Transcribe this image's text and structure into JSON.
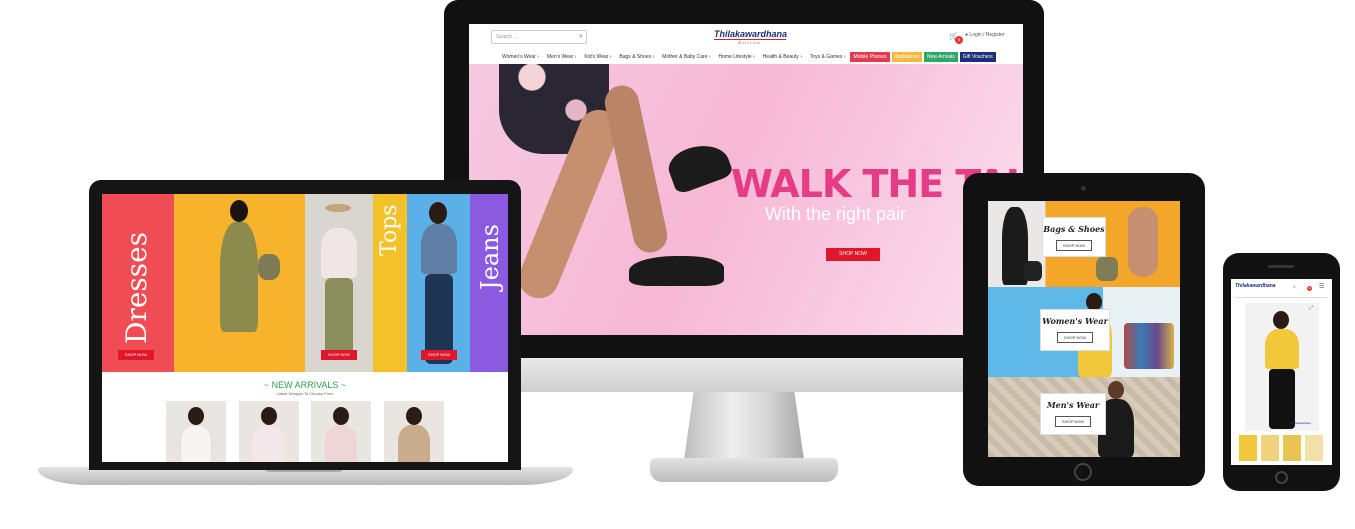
{
  "desktop": {
    "search_placeholder": "Search ...",
    "logo_main": "Thilakawardhana",
    "logo_sub": "Online",
    "cart_count": "0",
    "login": "Login / Register",
    "nav": [
      "Women's Wear",
      "Men's Wear",
      "Kid's Wear",
      "Bags & Shoes",
      "Mother & Baby Care",
      "Home Lifestyle",
      "Health & Beauty",
      "Toys & Games"
    ],
    "nav_highlight": [
      {
        "label": "Mobile Phones",
        "color": "#e53950"
      },
      {
        "label": "Appliances",
        "color": "#f5b942"
      },
      {
        "label": "New Arrivals",
        "color": "#2fa866"
      },
      {
        "label": "Gift Vouchers",
        "color": "#1e2f7a"
      }
    ],
    "hero": {
      "title": "WALK THE TALK",
      "subtitle": "With the right pair",
      "button": "SHOP NOW"
    }
  },
  "laptop": {
    "panels": [
      {
        "word": "Dresses",
        "color": "#ef4c53"
      },
      {
        "word": "Tops",
        "color": "#f3c12a"
      },
      {
        "word": "Jeans",
        "color": "#8a5be0"
      }
    ],
    "button": "SHOP NOW",
    "arrivals_title": "~ NEW ARRIVALS ~",
    "arrivals_sub": "Latest Designs To Choose From"
  },
  "tablet": {
    "cards": [
      {
        "title": "Bags & Shoes",
        "button": "SHOP NOW"
      },
      {
        "title": "Women's Wear",
        "button": "SHOP NOW"
      },
      {
        "title": "Men's Wear",
        "button": "SHOP NOW"
      }
    ]
  },
  "phone": {
    "logo_main": "Thilakawardhana",
    "cart_count": "0",
    "watermark": "thilakawardhana"
  },
  "colors": {
    "accent_red": "#e0162b",
    "hero_pink": "#e43d86",
    "arrivals_green": "#2e9e4f",
    "brand_blue": "#1c2e7a"
  }
}
